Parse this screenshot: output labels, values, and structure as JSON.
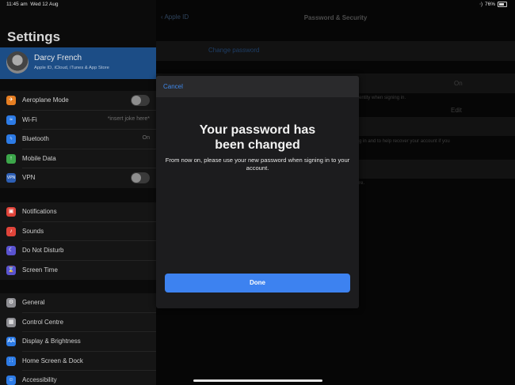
{
  "status_bar": {
    "time": "11:45 am",
    "date": "Wed 12 Aug",
    "battery": "76%"
  },
  "sidebar": {
    "title": "Settings",
    "profile": {
      "name": "Darcy French",
      "subtitle": "Apple ID, iCloud, iTunes & App Store"
    },
    "group1": [
      {
        "label": "Aeroplane Mode",
        "icon": "airplane-icon",
        "color": "#e67e22",
        "toggle": false
      },
      {
        "label": "Wi-Fi",
        "icon": "wifi-icon",
        "color": "#2d7be5",
        "value": "*insert joke here*"
      },
      {
        "label": "Bluetooth",
        "icon": "bluetooth-icon",
        "color": "#2d7be5",
        "value": "On"
      },
      {
        "label": "Mobile Data",
        "icon": "antenna-icon",
        "color": "#3ca64a"
      },
      {
        "label": "VPN",
        "icon": "vpn-icon",
        "color": "#2d5fb5",
        "toggle": false
      }
    ],
    "group2": [
      {
        "label": "Notifications",
        "icon": "notifications-icon",
        "color": "#e0443a"
      },
      {
        "label": "Sounds",
        "icon": "speaker-icon",
        "color": "#e0443a"
      },
      {
        "label": "Do Not Disturb",
        "icon": "moon-icon",
        "color": "#5a53d0"
      },
      {
        "label": "Screen Time",
        "icon": "hourglass-icon",
        "color": "#5a53d0"
      }
    ],
    "group3": [
      {
        "label": "General",
        "icon": "gear-icon",
        "color": "#8e8e93"
      },
      {
        "label": "Control Centre",
        "icon": "switches-icon",
        "color": "#8e8e93"
      },
      {
        "label": "Display & Brightness",
        "icon": "text-size-icon",
        "color": "#2d7be5"
      },
      {
        "label": "Home Screen & Dock",
        "icon": "grid-icon",
        "color": "#2d7be5"
      },
      {
        "label": "Accessibility",
        "icon": "accessibility-icon",
        "color": "#2d7be5"
      }
    ]
  },
  "detail": {
    "back_label": "Apple ID",
    "title": "Password & Security",
    "change_password": "Change password",
    "two_factor_value": "On",
    "identity_note": "entity when signing in.",
    "edit_label": "Edit",
    "recover_note": "g in and to help recover your account if you",
    "misc_note": "re."
  },
  "modal": {
    "cancel_label": "Cancel",
    "title": "Your password has been changed",
    "body": "From now on, please use your new password when signing in to your account.",
    "done_label": "Done"
  }
}
